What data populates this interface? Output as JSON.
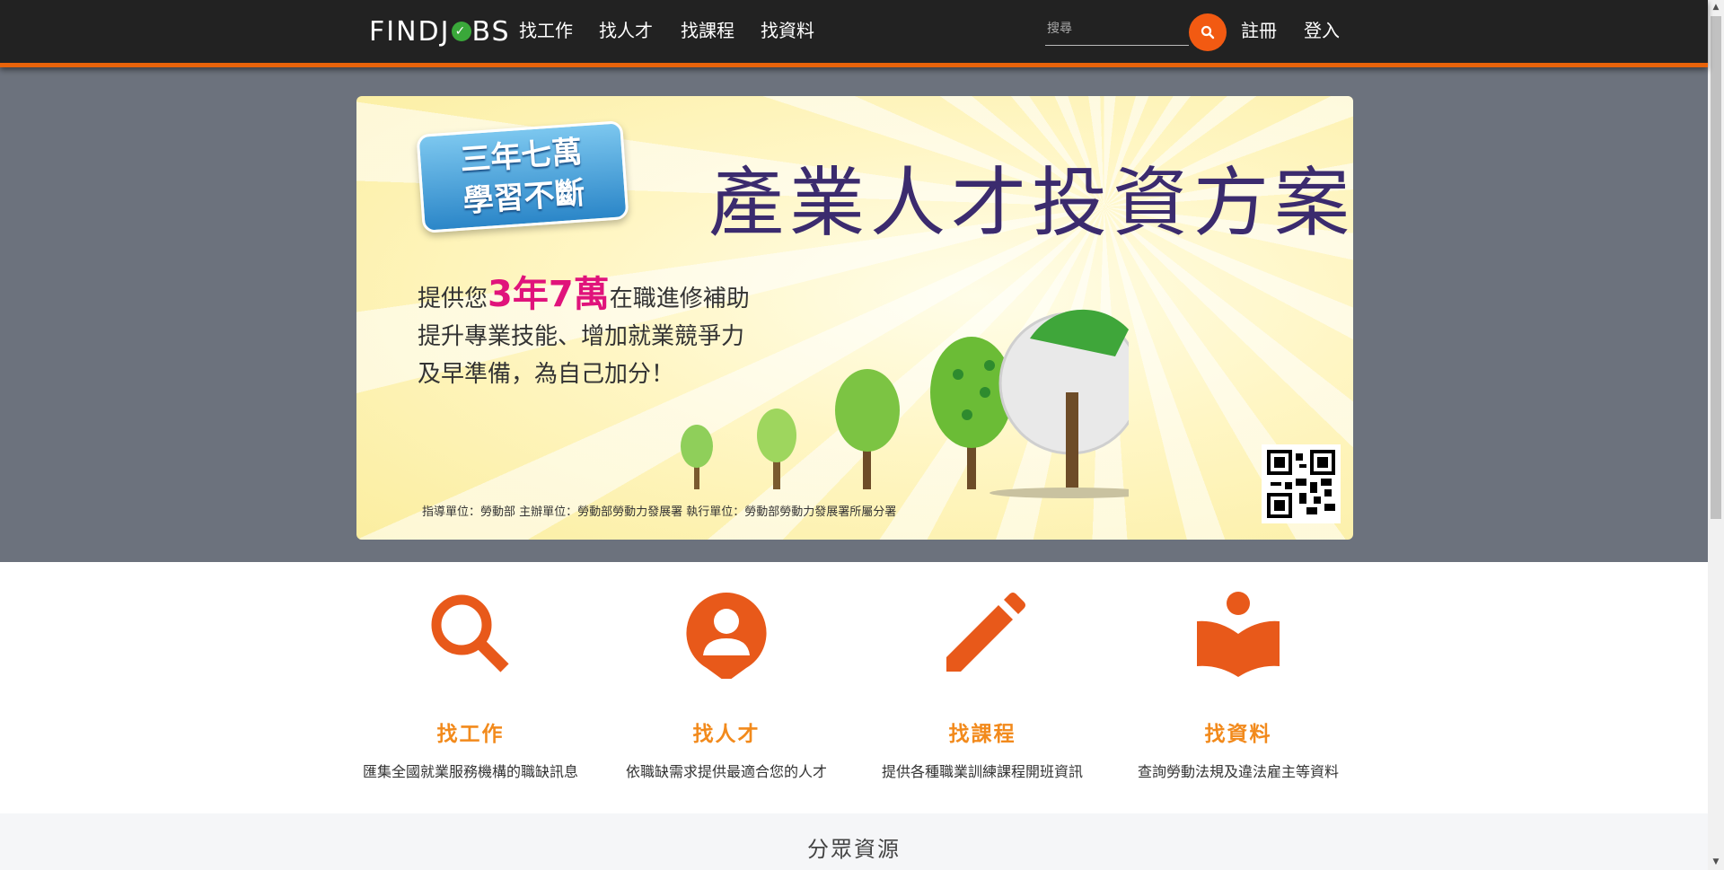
{
  "header": {
    "logo": {
      "prefix": "FINDJ",
      "check": "✓",
      "suffix": "BS"
    },
    "nav": [
      {
        "label": "找工作"
      },
      {
        "label": "找人才"
      },
      {
        "label": "找課程"
      },
      {
        "label": "找資料"
      }
    ],
    "search": {
      "placeholder": "搜尋",
      "value": ""
    },
    "register_label": "註冊",
    "login_label": "登入",
    "accent_color": "#e8630a"
  },
  "banner": {
    "badge_line1": "三年七萬",
    "badge_line2": "學習不斷",
    "title": "產業人才投資方案",
    "body_line1_pre": "提供您",
    "body_line1_highlight": "3年7萬",
    "body_line1_post": "在職進修補助",
    "body_line2": "提升專業技能、增加就業競爭力",
    "body_line3": "及早準備，為自己加分！",
    "footer": "指導單位：勞動部    主辦單位：勞動部勞動力發展署    執行單位：勞動部勞動力發展署所屬分署"
  },
  "features": [
    {
      "icon": "search-icon",
      "title": "找工作",
      "desc": "匯集全國就業服務機構的職缺訊息"
    },
    {
      "icon": "person-pin-icon",
      "title": "找人才",
      "desc": "依職缺需求提供最適合您的人才"
    },
    {
      "icon": "pencil-icon",
      "title": "找課程",
      "desc": "提供各種職業訓練課程開班資訊"
    },
    {
      "icon": "book-reader-icon",
      "title": "找資料",
      "desc": "查詢勞動法規及違法雇主等資料"
    }
  ],
  "section2": {
    "title": "分眾資源"
  },
  "colors": {
    "icon": "#e8591a",
    "feature_title": "#f28a1c",
    "hero_bg": "#6c727d",
    "topbar_bg": "#222222"
  }
}
